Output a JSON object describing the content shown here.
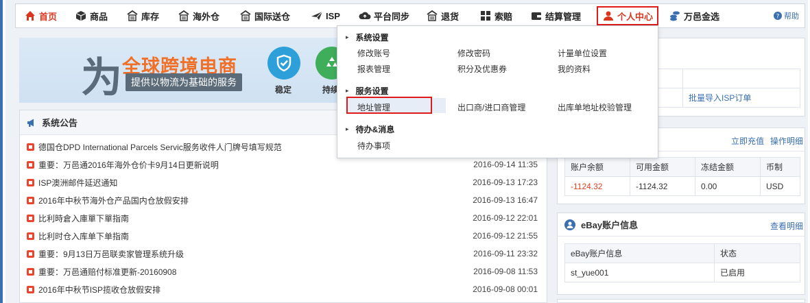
{
  "nav": {
    "items": [
      {
        "label": "首页",
        "icon": "home-icon"
      },
      {
        "label": "商品",
        "icon": "box-icon"
      },
      {
        "label": "库存",
        "icon": "warehouse-icon"
      },
      {
        "label": "海外仓",
        "icon": "warehouse-icon"
      },
      {
        "label": "国际送仓",
        "icon": "warehouse-icon"
      },
      {
        "label": "ISP",
        "icon": "plane-icon"
      },
      {
        "label": "平台同步",
        "icon": "cloud-upload-icon"
      },
      {
        "label": "退货",
        "icon": "warehouse-icon"
      },
      {
        "label": "索赔",
        "icon": "grid-icon"
      },
      {
        "label": "结算管理",
        "icon": "wallet-icon"
      },
      {
        "label": "个人中心",
        "icon": "user-icon"
      },
      {
        "label": "万邑金选",
        "icon": "coins-icon"
      }
    ],
    "help": "帮助"
  },
  "banner": {
    "big_char": "为",
    "title": "全球跨境电商",
    "subtitle": "提供以物流为基础的服务",
    "badges": [
      {
        "label": "稳定",
        "icon": "shield-check-icon",
        "color": "#2d9fd9"
      },
      {
        "label": "持续",
        "icon": "recycle-icon",
        "color": "#3fae5a"
      }
    ]
  },
  "announce": {
    "title": "系统公告",
    "rows": [
      {
        "text": "德国仓DPD International Parcels Servic服务收件人门牌号填写规范",
        "date": ""
      },
      {
        "text": "重要：万邑通2016年海外仓价卡9月14日更新说明",
        "date": "2016-09-14 11:35"
      },
      {
        "text": "ISP澳洲邮件延迟通知",
        "date": "2016-09-13 17:23"
      },
      {
        "text": "2016年中秋节海外仓产品国内仓放假安排",
        "date": "2016-09-13 16:47"
      },
      {
        "text": "比利時倉入庫單下單指南",
        "date": "2016-09-12 22:01"
      },
      {
        "text": "比利时仓入库单下单指南",
        "date": "2016-09-12 21:55"
      },
      {
        "text": "重要：9月13日万邑联卖家管理系统升级",
        "date": "2016-09-11 23:32"
      },
      {
        "text": "重要：万邑通赔付标准更新-20160908",
        "date": "2016-09-08 11:53"
      },
      {
        "text": "2016年中秋节ISP揽收仓放假安排",
        "date": "2016-09-08 00:01"
      }
    ]
  },
  "isp_panel": {
    "link": "批量导入ISP订单"
  },
  "account": {
    "links": [
      "立即充值",
      "操作明细"
    ],
    "headers": [
      "账户余额",
      "可用金额",
      "冻结金额",
      "币制"
    ],
    "values": [
      "-1124.32",
      "-1124.32",
      "0.00",
      "USD"
    ],
    "negative_color": "#e0401f"
  },
  "ebay": {
    "title": "eBay账户信息",
    "link": "查看明细",
    "headers": [
      "eBay账户信息",
      "状态"
    ],
    "values": [
      "st_yue001",
      "已启用"
    ]
  },
  "dropdown": {
    "sections": [
      {
        "title": "系统设置",
        "items": [
          "修改账号",
          "修改密码",
          "计量单位设置",
          "报表管理",
          "积分及优惠券",
          "我的资料"
        ]
      },
      {
        "title": "服务设置",
        "items": [
          "地址管理",
          "出口商/进口商管理",
          "出库单地址校验管理"
        ]
      },
      {
        "title": "待办&消息",
        "items": [
          "待办事项"
        ]
      }
    ]
  },
  "colors": {
    "accent": "#d9361f",
    "link": "#3a6fb0",
    "highlight_border": "#e01a1a"
  }
}
